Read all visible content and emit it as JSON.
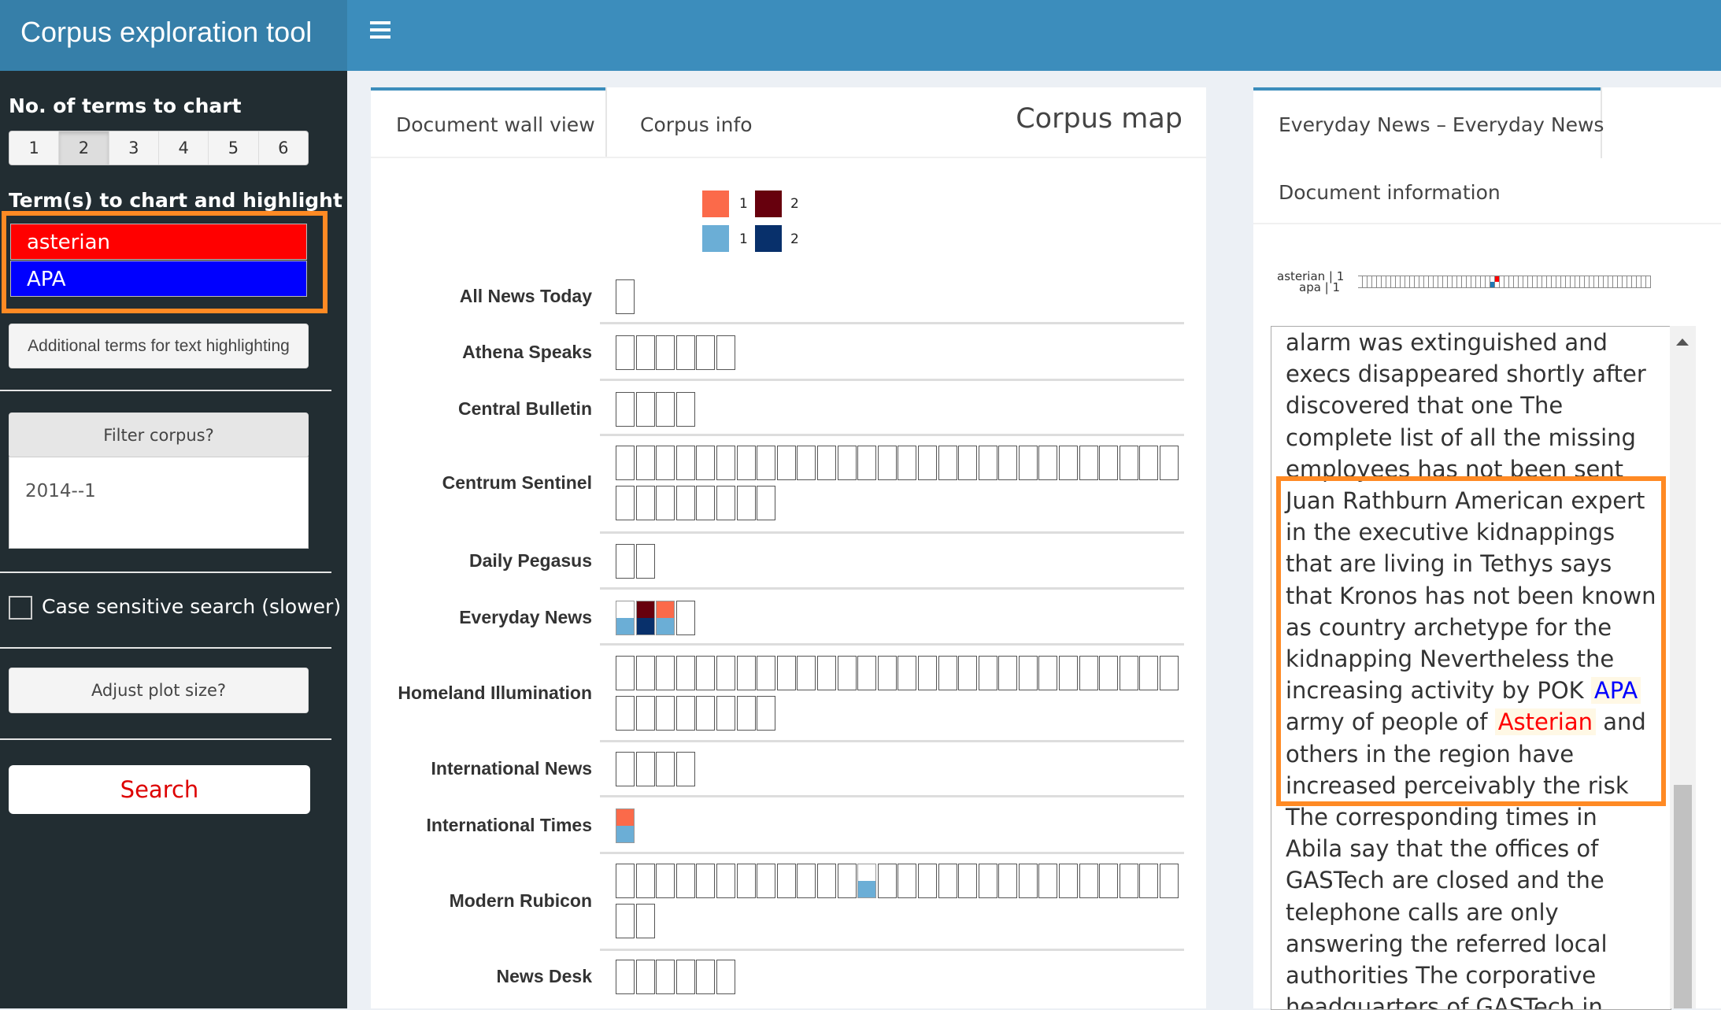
{
  "app": {
    "title": "Corpus exploration tool"
  },
  "sidebar": {
    "terms_count_label": "No. of terms to chart",
    "terms_count_options": [
      "1",
      "2",
      "3",
      "4",
      "5",
      "6"
    ],
    "terms_count_selected": "2",
    "terms_label": "Term(s) to chart and highlight",
    "terms": [
      {
        "text": "asterian",
        "color": "#ff0000"
      },
      {
        "text": "APA",
        "color": "#0000ff"
      }
    ],
    "additional_terms_button": "Additional terms for text highlighting",
    "filter_button": "Filter corpus?",
    "filter_value": "2014--1",
    "case_sensitive_label": "Case sensitive search (slower)",
    "case_sensitive_checked": false,
    "adjust_plot_button": "Adjust plot size?",
    "search_button": "Search"
  },
  "main": {
    "tabs": [
      "Document wall view",
      "Corpus info"
    ],
    "active_tab": "Document wall view",
    "title": "Corpus map",
    "legend": [
      {
        "color": "#fb6a4a",
        "label": "1"
      },
      {
        "color": "#67000d",
        "label": "2"
      },
      {
        "color": "#6baed6",
        "label": "1"
      },
      {
        "color": "#08306b",
        "label": "2"
      }
    ],
    "publications": [
      {
        "name": "All News Today",
        "docs": 1
      },
      {
        "name": "Athena Speaks",
        "docs": 6
      },
      {
        "name": "Central Bulletin",
        "docs": 4
      },
      {
        "name": "Centrum Sentinel",
        "docs": 36
      },
      {
        "name": "Daily Pegasus",
        "docs": 2
      },
      {
        "name": "Everyday News",
        "docs": 4,
        "hits": [
          {
            "index": 1,
            "top": "#ffffff",
            "bottom": "#6baed6"
          },
          {
            "index": 2,
            "top": "#67000d",
            "bottom": "#08306b"
          },
          {
            "index": 3,
            "top": "#fb6a4a",
            "bottom": "#6baed6"
          }
        ]
      },
      {
        "name": "Homeland Illumination",
        "docs": 36
      },
      {
        "name": "International News",
        "docs": 4
      },
      {
        "name": "International Times",
        "docs": 1,
        "hits": [
          {
            "index": 1,
            "top": "#fb6a4a",
            "bottom": "#6baed6"
          }
        ]
      },
      {
        "name": "Modern Rubicon",
        "docs": 30,
        "hits": [
          {
            "index": 13,
            "top": "#ffffff",
            "bottom": "#6baed6"
          }
        ]
      },
      {
        "name": "News Desk",
        "docs": 6
      }
    ]
  },
  "right": {
    "tabs": [
      "Everyday News – Everyday News",
      "Document information"
    ],
    "active_tab": "Everyday News – Everyday News",
    "strip_labels": [
      "asterian | 1",
      "apa | 1"
    ],
    "text_before": "alarm was extinguished and execs disappeared shortly after discovered that one The complete list of all the missing employees has not been sent",
    "text_hl_1": "Juan Rathburn American expert in the executive kidnappings that are living in Tethys says that Kronos has not been known as country archetype for the kidnapping Nevertheless the increasing activity by POK",
    "term_apa": "APA",
    "text_hl_2": "army of people of",
    "term_asterian": "Asterian",
    "text_hl_3": "and others in the region have increased perceivably the risk",
    "text_after": "The corresponding times in Abila say that the offices of GASTech are closed and the telephone calls are only answering the referred local authorities The corporative headquarters of GASTech in Tethys have rejected"
  },
  "colors": {
    "brand": "#367fa9",
    "header": "#3c8dbc",
    "sidebar": "#222d32",
    "highlight_box": "#ff8a24"
  }
}
